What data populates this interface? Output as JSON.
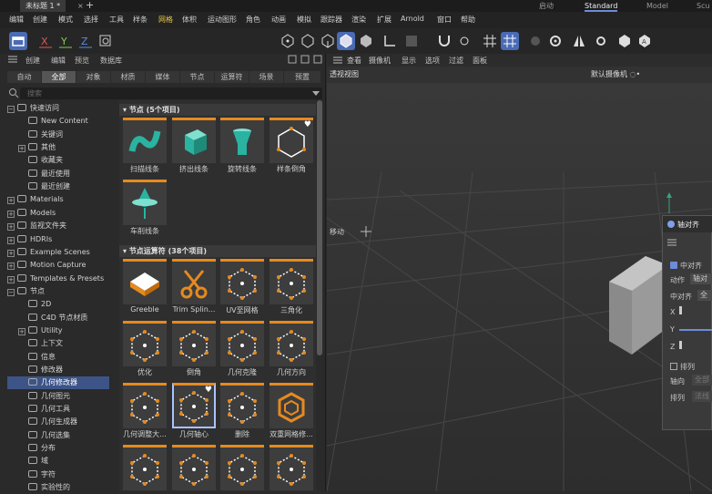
{
  "titlebar": {
    "tab": "未标题 1 *",
    "close": "×",
    "plus": "+",
    "layouts": [
      {
        "label": "启动",
        "active": false
      },
      {
        "label": "Standard",
        "active": true
      },
      {
        "label": "Model",
        "active": false
      },
      {
        "label": "Scu",
        "active": false
      }
    ]
  },
  "menu": [
    "编辑",
    "创建",
    "模式",
    "选择",
    "工具",
    "样条",
    "网格",
    "体积",
    "运动图形",
    "角色",
    "动画",
    "模拟",
    "跟踪器",
    "渲染",
    "扩展",
    "Arnold",
    "窗口",
    "帮助"
  ],
  "menu_highlight": "网格",
  "axes": [
    "X",
    "Y",
    "Z"
  ],
  "panel": {
    "header": [
      "创建",
      "编辑",
      "预览",
      "数据库"
    ],
    "filters": [
      "自动",
      "全部",
      "对象",
      "材质",
      "媒体",
      "节点",
      "运算符",
      "场景",
      "预置"
    ],
    "active_filter": "全部",
    "search_placeholder": "搜索"
  },
  "tree": [
    {
      "label": "快速访问",
      "level": 0,
      "expand": "−"
    },
    {
      "label": "New Content",
      "level": 1,
      "expand": ""
    },
    {
      "label": "关键词",
      "level": 1,
      "expand": ""
    },
    {
      "label": "其他",
      "level": 1,
      "expand": "+"
    },
    {
      "label": "收藏夹",
      "level": 1,
      "expand": ""
    },
    {
      "label": "最近使用",
      "level": 1,
      "expand": ""
    },
    {
      "label": "最近创建",
      "level": 1,
      "expand": ""
    },
    {
      "label": "Materials",
      "level": 0,
      "expand": "+"
    },
    {
      "label": "Models",
      "level": 0,
      "expand": "+"
    },
    {
      "label": "监视文件夹",
      "level": 0,
      "expand": "+"
    },
    {
      "label": "HDRIs",
      "level": 0,
      "expand": "+"
    },
    {
      "label": "Example Scenes",
      "level": 0,
      "expand": "+"
    },
    {
      "label": "Motion Capture",
      "level": 0,
      "expand": "+"
    },
    {
      "label": "Templates & Presets",
      "level": 0,
      "expand": "+"
    },
    {
      "label": "节点",
      "level": 0,
      "expand": "−"
    },
    {
      "label": "2D",
      "level": 1,
      "expand": ""
    },
    {
      "label": "C4D 节点材质",
      "level": 1,
      "expand": ""
    },
    {
      "label": "Utility",
      "level": 1,
      "expand": "+"
    },
    {
      "label": "上下文",
      "level": 1,
      "expand": ""
    },
    {
      "label": "信息",
      "level": 1,
      "expand": ""
    },
    {
      "label": "修改器",
      "level": 1,
      "expand": ""
    },
    {
      "label": "几何修改器",
      "level": 1,
      "expand": "",
      "selected": true
    },
    {
      "label": "几何图元",
      "level": 1,
      "expand": ""
    },
    {
      "label": "几何工具",
      "level": 1,
      "expand": ""
    },
    {
      "label": "几何生成器",
      "level": 1,
      "expand": ""
    },
    {
      "label": "几何选集",
      "level": 1,
      "expand": ""
    },
    {
      "label": "分布",
      "level": 1,
      "expand": ""
    },
    {
      "label": "域",
      "level": 1,
      "expand": ""
    },
    {
      "label": "字符",
      "level": 1,
      "expand": ""
    },
    {
      "label": "实验性的",
      "level": 1,
      "expand": ""
    }
  ],
  "sections": [
    {
      "title": "节点 (5个项目)",
      "items": [
        {
          "label": "扫描线条",
          "icon": "sweep-icon"
        },
        {
          "label": "挤出线条",
          "icon": "extrude-icon"
        },
        {
          "label": "旋转线条",
          "icon": "lathe-icon"
        },
        {
          "label": "样条倒角",
          "icon": "bevel-icon",
          "fav": true
        },
        {
          "label": "车削线条",
          "icon": "lathe-drop-icon"
        }
      ]
    },
    {
      "title": "节点运算符 (38个项目)",
      "items": [
        {
          "label": "Greeble",
          "icon": "greeble-icon"
        },
        {
          "label": "Trim Splin...",
          "icon": "scissors-icon"
        },
        {
          "label": "UV至网格",
          "icon": "cube-icon"
        },
        {
          "label": "三角化",
          "icon": "cube-icon"
        },
        {
          "label": "优化",
          "icon": "cube-icon"
        },
        {
          "label": "倒角",
          "icon": "cube-icon"
        },
        {
          "label": "几何克隆",
          "icon": "cube-icon"
        },
        {
          "label": "几何方向",
          "icon": "cube-icon"
        },
        {
          "label": "几何调整大...",
          "icon": "cube-icon"
        },
        {
          "label": "几何轴心",
          "icon": "cube-icon",
          "selected": true,
          "fav": true
        },
        {
          "label": "删除",
          "icon": "cube-icon"
        },
        {
          "label": "双重网格修...",
          "icon": "dual-mesh-icon"
        },
        {
          "label": "",
          "icon": "cube-icon"
        },
        {
          "label": "",
          "icon": "cube-icon"
        },
        {
          "label": "",
          "icon": "cube-icon"
        },
        {
          "label": "",
          "icon": "cube-icon"
        }
      ]
    }
  ],
  "viewport": {
    "menu": [
      "查看",
      "摄像机",
      "显示",
      "选项",
      "过滤",
      "面板"
    ],
    "title": "透视视图",
    "camera": "默认摄像机 ◌•",
    "move_label": "移动"
  },
  "attr": {
    "title": "轴对齐",
    "check_label": "中对齐",
    "action_label": "动作",
    "action_value": "轴对齐",
    "align_label": "中对齐",
    "align_value": "全部",
    "x": "X",
    "y": "Y",
    "z": "Z",
    "arrange_label": "排列",
    "axis_label": "轴向",
    "axis_value": "全部",
    "arrange2_label": "排列",
    "arrange2_value": "法线"
  },
  "colors": {
    "accent": "#e58a1f",
    "selection": "#3c5487",
    "highlight": "#e3c64a"
  }
}
